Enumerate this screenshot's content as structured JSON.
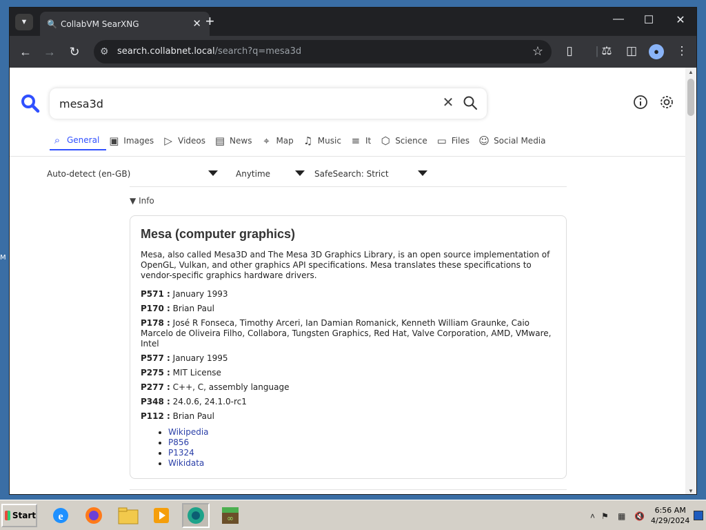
{
  "desktop": {
    "edge_text": "M"
  },
  "browser": {
    "tab_title": "CollabVM SearXNG",
    "url_host": "search.collabnet.local",
    "url_path": "/search?q=mesa3d"
  },
  "search": {
    "query": "mesa3d",
    "categories": [
      {
        "label": "General",
        "icon": "search-icon",
        "active": true
      },
      {
        "label": "Images",
        "icon": "image-icon"
      },
      {
        "label": "Videos",
        "icon": "play-icon"
      },
      {
        "label": "News",
        "icon": "newspaper-icon"
      },
      {
        "label": "Map",
        "icon": "map-pin-icon"
      },
      {
        "label": "Music",
        "icon": "music-icon"
      },
      {
        "label": "It",
        "icon": "layers-icon"
      },
      {
        "label": "Science",
        "icon": "box-icon"
      },
      {
        "label": "Files",
        "icon": "inbox-icon"
      },
      {
        "label": "Social Media",
        "icon": "people-icon"
      }
    ],
    "filters": {
      "language": "Auto-detect (en-GB)",
      "time": "Anytime",
      "safesearch": "SafeSearch: Strict"
    }
  },
  "infobox": {
    "toggle_label": "Info",
    "title": "Mesa (computer graphics)",
    "description": "Mesa, also called Mesa3D and The Mesa 3D Graphics Library, is an open source implementation of OpenGL, Vulkan, and other graphics API specifications. Mesa translates these specifications to vendor-specific graphics hardware drivers.",
    "attributes": [
      {
        "key": "P571 :",
        "value": "January 1993"
      },
      {
        "key": "P170 :",
        "value": "Brian Paul"
      },
      {
        "key": "P178 :",
        "value": "José R Fonseca, Timothy Arceri, Ian Damian Romanick, Kenneth William Graunke, Caio Marcelo de Oliveira Filho, Collabora, Tungsten Graphics, Red Hat, Valve Corporation, AMD, VMware, Intel"
      },
      {
        "key": "P577 :",
        "value": "January 1995"
      },
      {
        "key": "P275 :",
        "value": "MIT License"
      },
      {
        "key": "P277 :",
        "value": "C++, C, assembly language"
      },
      {
        "key": "P348 :",
        "value": "24.0.6, 24.1.0-rc1"
      },
      {
        "key": "P112 :",
        "value": "Brian Paul"
      }
    ],
    "links": [
      "Wikipedia",
      "P856",
      "P1324",
      "Wikidata"
    ]
  },
  "taskbar": {
    "start_label": "Start",
    "time": "6:56 AM",
    "date": "4/29/2024"
  },
  "colors": {
    "accent": "#3050ff",
    "link": "#2a3fa8",
    "chrome_dark": "#202124",
    "chrome_toolbar": "#35363a"
  }
}
